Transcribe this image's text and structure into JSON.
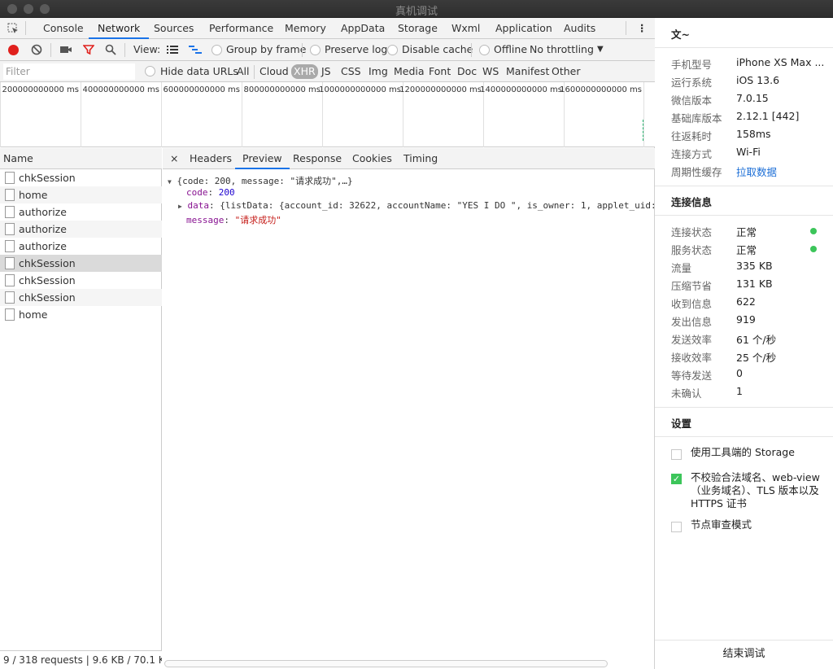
{
  "window": {
    "title": "真机调试"
  },
  "tabs": [
    "Console",
    "Network",
    "Sources",
    "Performance",
    "Memory",
    "AppData",
    "Storage",
    "Wxml",
    "Application",
    "Audits"
  ],
  "toolbar": {
    "view_label": "View:",
    "group_by_frame": "Group by frame",
    "preserve_log": "Preserve log",
    "disable_cache": "Disable cache",
    "offline": "Offline",
    "throttling": "No throttling"
  },
  "filterbar": {
    "placeholder": "Filter",
    "hide_data_urls": "Hide data URLs",
    "types": [
      "All",
      "Cloud",
      "XHR",
      "JS",
      "CSS",
      "Img",
      "Media",
      "Font",
      "Doc",
      "WS",
      "Manifest",
      "Other"
    ],
    "active_type": "XHR"
  },
  "timeline": {
    "labels": [
      "200000000000 ms",
      "400000000000 ms",
      "600000000000 ms",
      "800000000000 ms",
      "1000000000000 ms",
      "1200000000000 ms",
      "1400000000000 ms",
      "1600000000000 ms"
    ]
  },
  "requests": {
    "header": "Name",
    "items": [
      "chkSession",
      "home",
      "authorize",
      "authorize",
      "authorize",
      "chkSession",
      "chkSession",
      "chkSession",
      "home"
    ],
    "selected_index": 5,
    "status": "9 / 318 requests | 9.6 KB / 70.1 K..."
  },
  "detail": {
    "close": "×",
    "tabs": [
      "Headers",
      "Preview",
      "Response",
      "Cookies",
      "Timing"
    ],
    "active_tab": "Preview",
    "preview": {
      "root": "{code: 200, message: \"请求成功\",…}",
      "code_key": "code",
      "code_val": "200",
      "data_key": "data",
      "data_val": "{listData: {account_id: 32622, accountName: \"YES I DO \", is_owner: 1, applet_uid:",
      "message_key": "message",
      "message_val": "\"请求成功\""
    }
  },
  "side": {
    "user": "文~",
    "device": [
      {
        "k": "手机型号",
        "v": "iPhone XS Max ..."
      },
      {
        "k": "运行系统",
        "v": "iOS 13.6"
      },
      {
        "k": "微信版本",
        "v": "7.0.15"
      },
      {
        "k": "基础库版本",
        "v": "2.12.1 [442]"
      },
      {
        "k": "往返耗时",
        "v": "158ms"
      },
      {
        "k": "连接方式",
        "v": "Wi-Fi"
      },
      {
        "k": "周期性缓存",
        "v": "拉取数据"
      }
    ],
    "conn_title": "连接信息",
    "conn": [
      {
        "k": "连接状态",
        "v": "正常"
      },
      {
        "k": "服务状态",
        "v": "正常"
      },
      {
        "k": "流量",
        "v": "335 KB"
      },
      {
        "k": "压缩节省",
        "v": "131 KB"
      },
      {
        "k": "收到信息",
        "v": "622"
      },
      {
        "k": "发出信息",
        "v": "919"
      },
      {
        "k": "发送效率",
        "v": "61 个/秒"
      },
      {
        "k": "接收效率",
        "v": "25 个/秒"
      },
      {
        "k": "等待发送",
        "v": "0"
      },
      {
        "k": "未确认",
        "v": "1"
      }
    ],
    "settings_title": "设置",
    "settings": [
      {
        "label": "使用工具端的 Storage",
        "checked": false
      },
      {
        "label": "不校验合法域名、web-view（业务域名）、TLS 版本以及 HTTPS 证书",
        "checked": true
      },
      {
        "label": "节点审查模式",
        "checked": false
      }
    ],
    "end_button": "结束调试"
  },
  "colors": {
    "accent": "#1a73e8",
    "green": "#3cc55a",
    "record": "#e0201c"
  }
}
